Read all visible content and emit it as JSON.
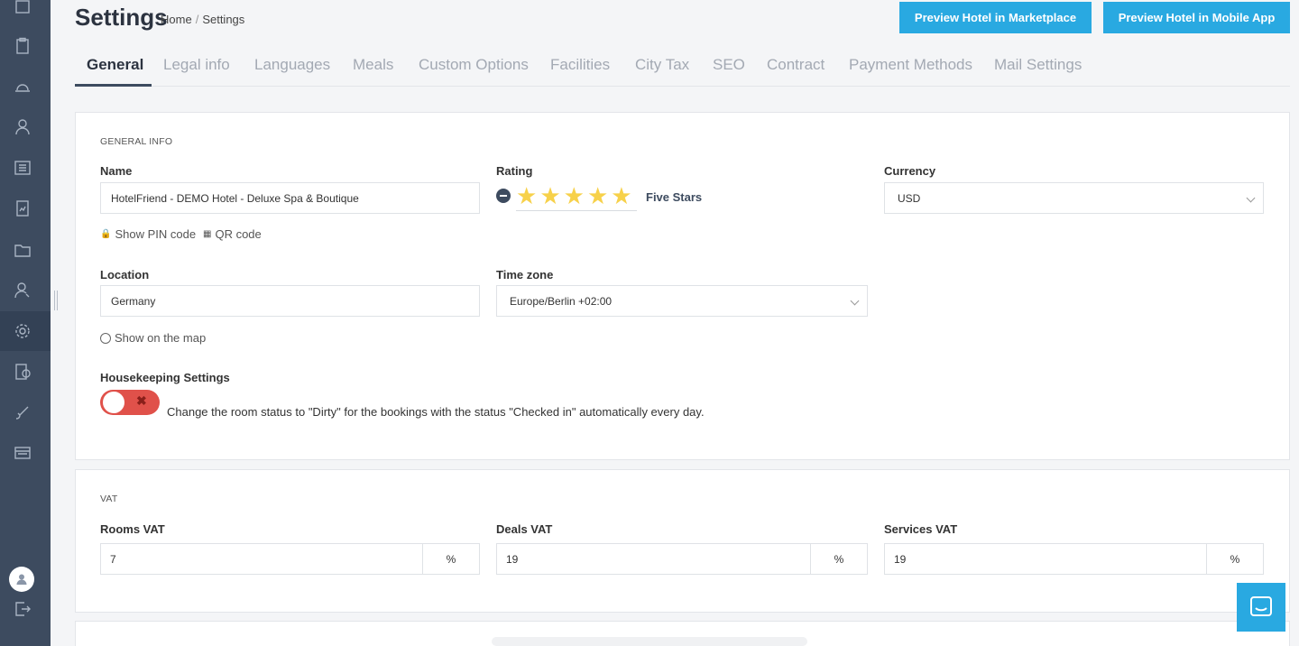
{
  "header": {
    "title": "Settings",
    "breadcrumb": [
      "Home",
      "Settings"
    ],
    "btn_marketplace": "Preview Hotel in Marketplace",
    "btn_mobile": "Preview Hotel in Mobile App"
  },
  "tabs": [
    "General",
    "Legal info",
    "Languages",
    "Meals",
    "Custom Options",
    "Facilities",
    "City Tax",
    "SEO",
    "Contract",
    "Payment Methods",
    "Mail Settings"
  ],
  "general": {
    "section": "GENERAL INFO",
    "name_label": "Name",
    "name_value": "HotelFriend - DEMO Hotel - Deluxe Spa & Boutique",
    "show_pin": "Show PIN code",
    "qr_code": "QR code",
    "rating_label": "Rating",
    "rating_stars": 5,
    "rating_text": "Five Stars",
    "currency_label": "Currency",
    "currency_value": "USD",
    "location_label": "Location",
    "location_value": "Germany",
    "timezone_label": "Time zone",
    "timezone_value": "Europe/Berlin +02:00",
    "show_map": "Show on the map",
    "housekeeping_label": "Housekeeping Settings",
    "housekeeping_enabled": false,
    "housekeeping_text": "Change the room status to \"Dirty\" for the bookings with the status \"Checked in\" automatically every day."
  },
  "vat": {
    "section": "VAT",
    "rooms_label": "Rooms VAT",
    "rooms_value": "7",
    "deals_label": "Deals VAT",
    "deals_value": "19",
    "services_label": "Services VAT",
    "services_value": "19",
    "suffix": "%"
  },
  "colors": {
    "sidebar": "#3d4b5f",
    "accent": "#29a9e1",
    "toggle_off": "#e0514a",
    "star": "#f7d14a"
  }
}
